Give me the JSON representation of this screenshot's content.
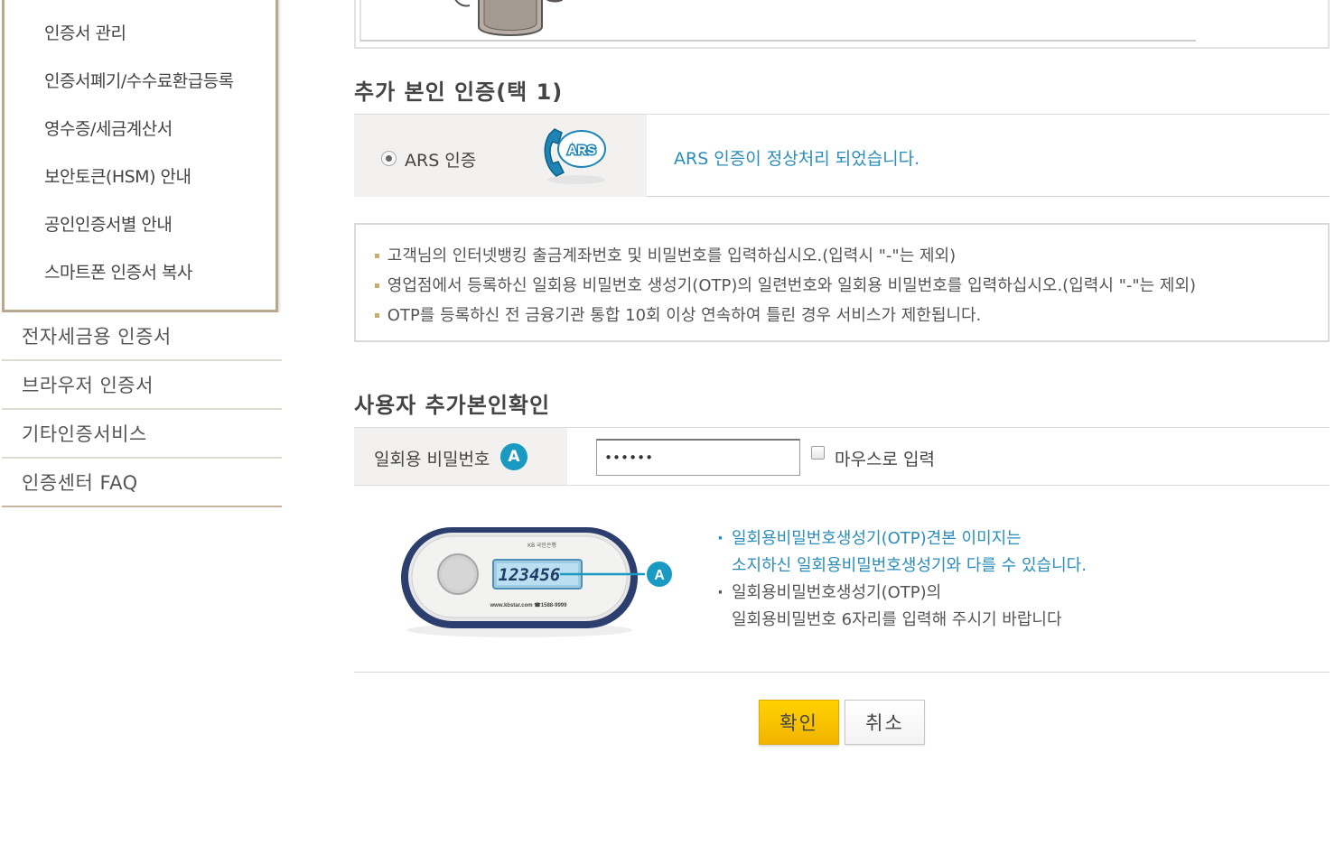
{
  "sidebar": {
    "submenu": [
      {
        "label": "인증서 관리"
      },
      {
        "label": "인증서폐기/수수료환급등록"
      },
      {
        "label": "영수증/세금계산서"
      },
      {
        "label": "보안토큰(HSM) 안내"
      },
      {
        "label": "공인인증서별 안내"
      },
      {
        "label": "스마트폰 인증서 복사"
      }
    ],
    "menu": [
      {
        "label": "전자세금용 인증서"
      },
      {
        "label": "브라우저 인증서"
      },
      {
        "label": "기타인증서비스"
      },
      {
        "label": "인증센터 FAQ"
      }
    ]
  },
  "additional_auth": {
    "title": "추가 본인 인증(택 1)",
    "ars_option_label": "ARS 인증",
    "ars_icon_text": "ARS",
    "ars_status": "ARS 인증이 정상처리 되었습니다."
  },
  "notices": [
    "고객님의 인터넷뱅킹 출금계좌번호 및 비밀번호를 입력하십시오.(입력시 \"-\"는 제외)",
    "영업점에서 등록하신 일회용 비밀번호 생성기(OTP)의 일련번호와 일회용 비밀번호를 입력하십시오.(입력시 \"-\"는 제외)",
    "OTP를 등록하신 전 금융기관 통합 10회 이상 연속하여 틀린 경우 서비스가 제한됩니다."
  ],
  "user_verify": {
    "title": "사용자 추가본인확인",
    "otp_label": "일회용 비밀번호",
    "badge": "A",
    "otp_value": "••••••",
    "mouse_input_label": "마우스로 입력"
  },
  "otp_device": {
    "display_number": "123456",
    "callout": "A",
    "top_text": "KB 국민은행",
    "bottom_text": "www.kbstar.com ☎1588-9999"
  },
  "otp_help": {
    "line1a": "일회용비밀번호생성기(OTP)견본 이미지는",
    "line1b": "소지하신 일회용비밀번호생성기와 다를 수 있습니다.",
    "line2a": "일회용비밀번호생성기(OTP)의",
    "line2b": "일회용비밀번호 6자리를 입력해 주시기 바랍니다"
  },
  "buttons": {
    "confirm": "확인",
    "cancel": "취소"
  },
  "colors": {
    "accent_blue": "#2a8dbb",
    "confirm_yellow": "#f7c400",
    "sidebar_border": "#b9a890"
  }
}
